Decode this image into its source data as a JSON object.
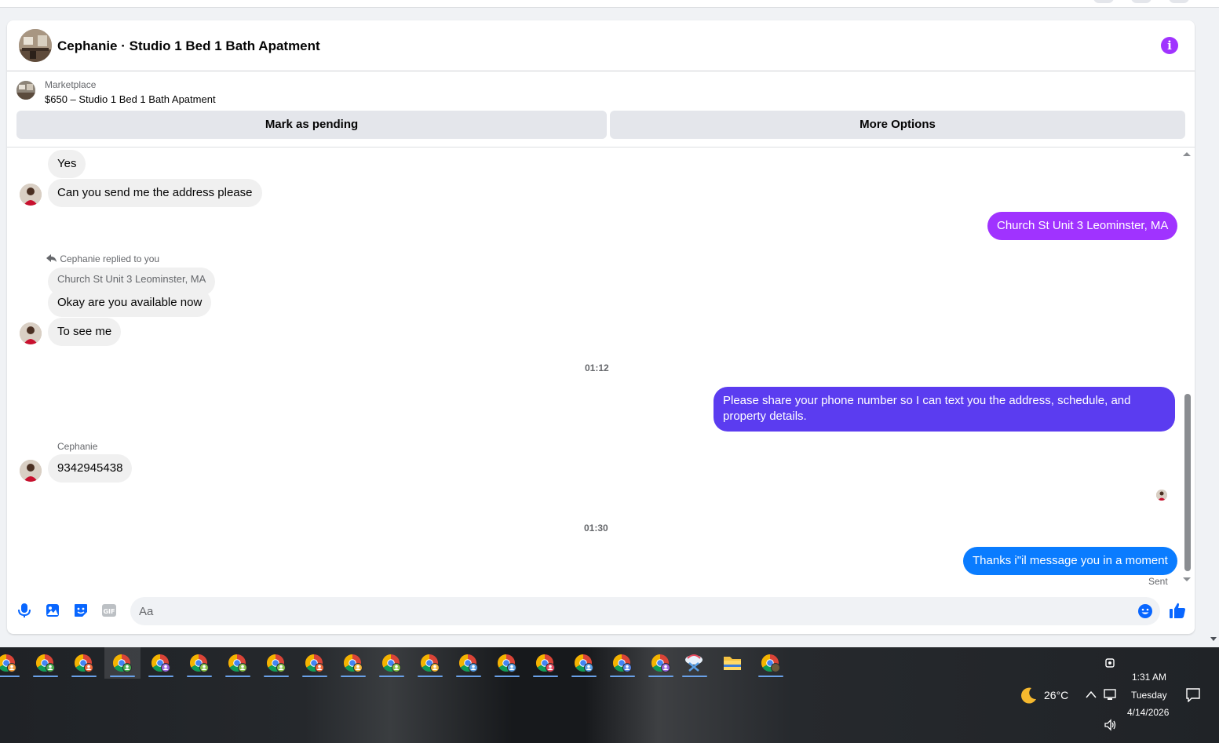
{
  "header": {
    "title": "Cephanie · Studio 1 Bed 1 Bath Apatment"
  },
  "listing": {
    "label": "Marketplace",
    "name": "$650 – Studio 1 Bed 1 Bath Apatment",
    "mark_pending_label": "Mark as pending",
    "more_options_label": "More Options"
  },
  "messages": {
    "m1": "Yes",
    "m2": "Can you send me the address please",
    "m3": "Church St Unit 3 Leominster, MA",
    "reply_indicator": "Cephanie replied to you",
    "quoted": "Church St Unit 3 Leominster, MA",
    "m4": "Okay are you available now",
    "m5": "To see me",
    "time1": "01:12",
    "m6_line1": "Please share your phone number so I can text you the address, schedule, and",
    "m6_line2": "property details.",
    "sender_name": "Cephanie",
    "m7": "9342945438",
    "time2": "01:30",
    "m8": "Thanks i\"il message you in a moment",
    "status": "Sent"
  },
  "composer": {
    "placeholder": "Aa"
  },
  "colors": {
    "outgoing_purple": "#a033ff",
    "outgoing_indigo": "#5b3cf0",
    "outgoing_blue": "#0a7cff",
    "messenger_blue": "#0866ff"
  },
  "taskbar": {
    "weather": "26°C",
    "time": "1:31 AM",
    "day": "Tuesday",
    "date": "4/14/2026"
  }
}
